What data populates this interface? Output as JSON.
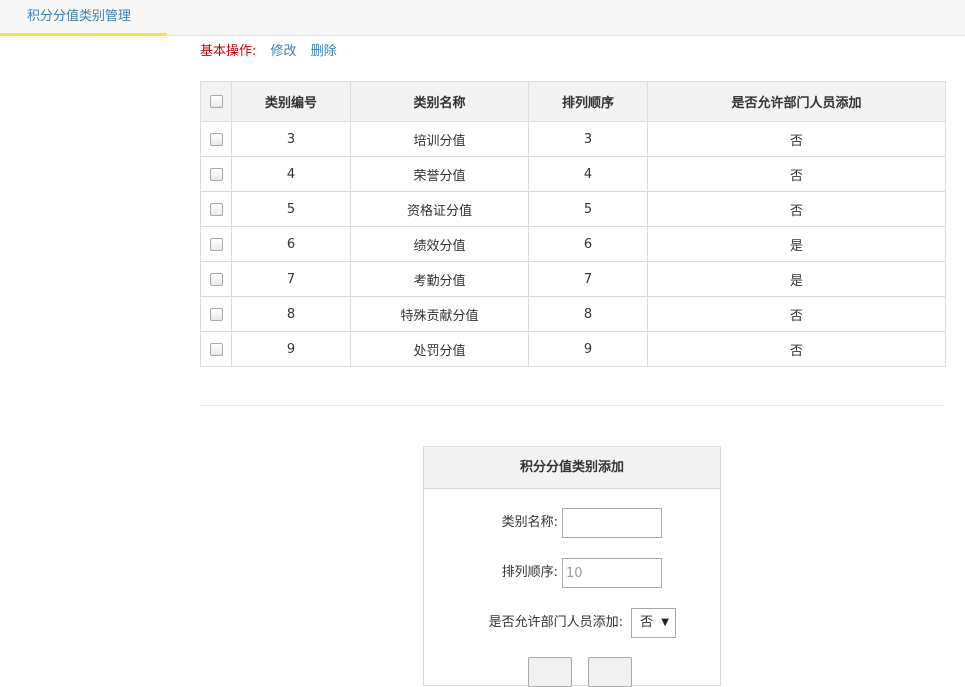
{
  "tab": {
    "label": "积分分值类别管理"
  },
  "ops": {
    "label": "基本操作:",
    "edit": "修改",
    "delete": "删除"
  },
  "table": {
    "headers": [
      "类别编号",
      "类别名称",
      "排列顺序",
      "是否允许部门人员添加"
    ],
    "rows": [
      {
        "id": "3",
        "name": "培训分值",
        "order": "3",
        "allow": "否"
      },
      {
        "id": "4",
        "name": "荣誉分值",
        "order": "4",
        "allow": "否"
      },
      {
        "id": "5",
        "name": "资格证分值",
        "order": "5",
        "allow": "否"
      },
      {
        "id": "6",
        "name": "绩效分值",
        "order": "6",
        "allow": "是"
      },
      {
        "id": "7",
        "name": "考勤分值",
        "order": "7",
        "allow": "是"
      },
      {
        "id": "8",
        "name": "特殊贡献分值",
        "order": "8",
        "allow": "否"
      },
      {
        "id": "9",
        "name": "处罚分值",
        "order": "9",
        "allow": "否"
      }
    ]
  },
  "form": {
    "title": "积分分值类别添加",
    "name_label": "类别名称:",
    "name_value": "",
    "order_label": "排列顺序:",
    "order_placeholder": "10",
    "allow_label": "是否允许部门人员添加:",
    "allow_selected": "否"
  }
}
